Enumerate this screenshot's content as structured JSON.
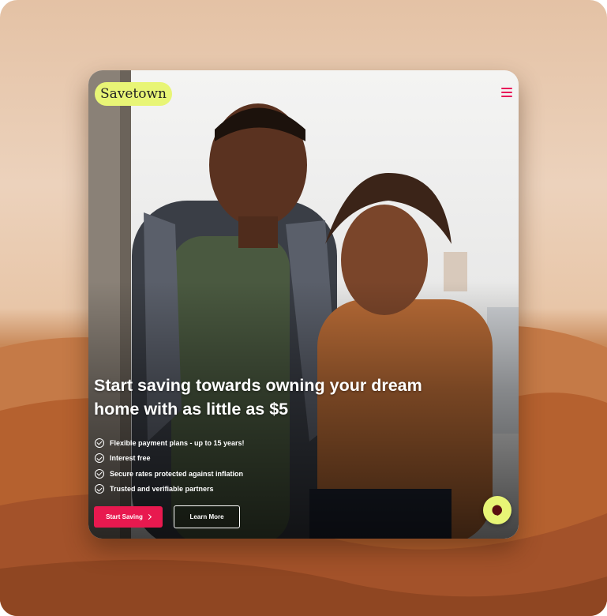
{
  "brand": {
    "logo_text": "Savetown",
    "accent": "#e8194f",
    "logo_bg": "#e8f576"
  },
  "header": {
    "menu_icon": "hamburger-menu-icon"
  },
  "hero": {
    "headline": "Start saving towards owning your dream home with as little as $5",
    "features": [
      "Flexible payment plans - up to 15 years!",
      "Interest free",
      "Secure rates protected against inflation",
      "Trusted and verifiable partners"
    ],
    "primary_cta": "Start Saving",
    "secondary_cta": "Learn More"
  },
  "chat": {
    "icon": "chat-bubble-icon"
  }
}
